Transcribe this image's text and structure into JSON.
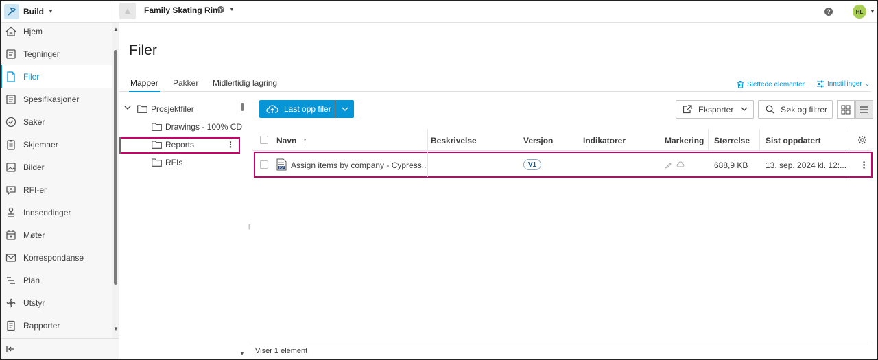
{
  "app": {
    "name": "Build"
  },
  "project": {
    "name": "Family Skating Rink"
  },
  "user": {
    "initials": "HL"
  },
  "sidebar": {
    "items": [
      {
        "label": "Hjem",
        "icon": "home-icon"
      },
      {
        "label": "Tegninger",
        "icon": "sheets-icon"
      },
      {
        "label": "Filer",
        "icon": "files-icon",
        "active": true
      },
      {
        "label": "Spesifikasjoner",
        "icon": "specifications-icon"
      },
      {
        "label": "Saker",
        "icon": "issues-icon"
      },
      {
        "label": "Skjemaer",
        "icon": "forms-icon"
      },
      {
        "label": "Bilder",
        "icon": "photos-icon"
      },
      {
        "label": "RFI-er",
        "icon": "rfi-icon"
      },
      {
        "label": "Innsendinger",
        "icon": "submittals-icon"
      },
      {
        "label": "Møter",
        "icon": "meetings-icon"
      },
      {
        "label": "Korrespondanse",
        "icon": "correspondence-icon"
      },
      {
        "label": "Plan",
        "icon": "schedule-icon"
      },
      {
        "label": "Utstyr",
        "icon": "assets-icon"
      },
      {
        "label": "Rapporter",
        "icon": "reports-icon"
      }
    ]
  },
  "page": {
    "title": "Filer"
  },
  "tabs": [
    {
      "label": "Mapper",
      "active": true
    },
    {
      "label": "Pakker"
    },
    {
      "label": "Midlertidig lagring"
    }
  ],
  "links": {
    "deleted": "Slettede elementer",
    "settings": "Innstillinger"
  },
  "tree": {
    "root": "Prosjektfiler",
    "folders": [
      "Drawings - 100% CD",
      "Reports",
      "RFIs"
    ],
    "selected": "Reports"
  },
  "toolbar": {
    "upload": "Last opp filer",
    "export": "Eksporter",
    "search": "Søk og filtrer"
  },
  "table": {
    "columns": [
      "Navn",
      "Beskrivelse",
      "Versjon",
      "Indikatorer",
      "Markering",
      "Størrelse",
      "Sist oppdatert"
    ],
    "rows": [
      {
        "name": "Assign items by company - Cypress...",
        "description": "",
        "version": "V1",
        "size": "688,9 KB",
        "updated": "13. sep. 2024 kl. 12:..."
      }
    ]
  },
  "footer": {
    "status": "Viser 1 element"
  },
  "colors": {
    "accent": "#0696d7",
    "highlight": "#c7006c"
  }
}
